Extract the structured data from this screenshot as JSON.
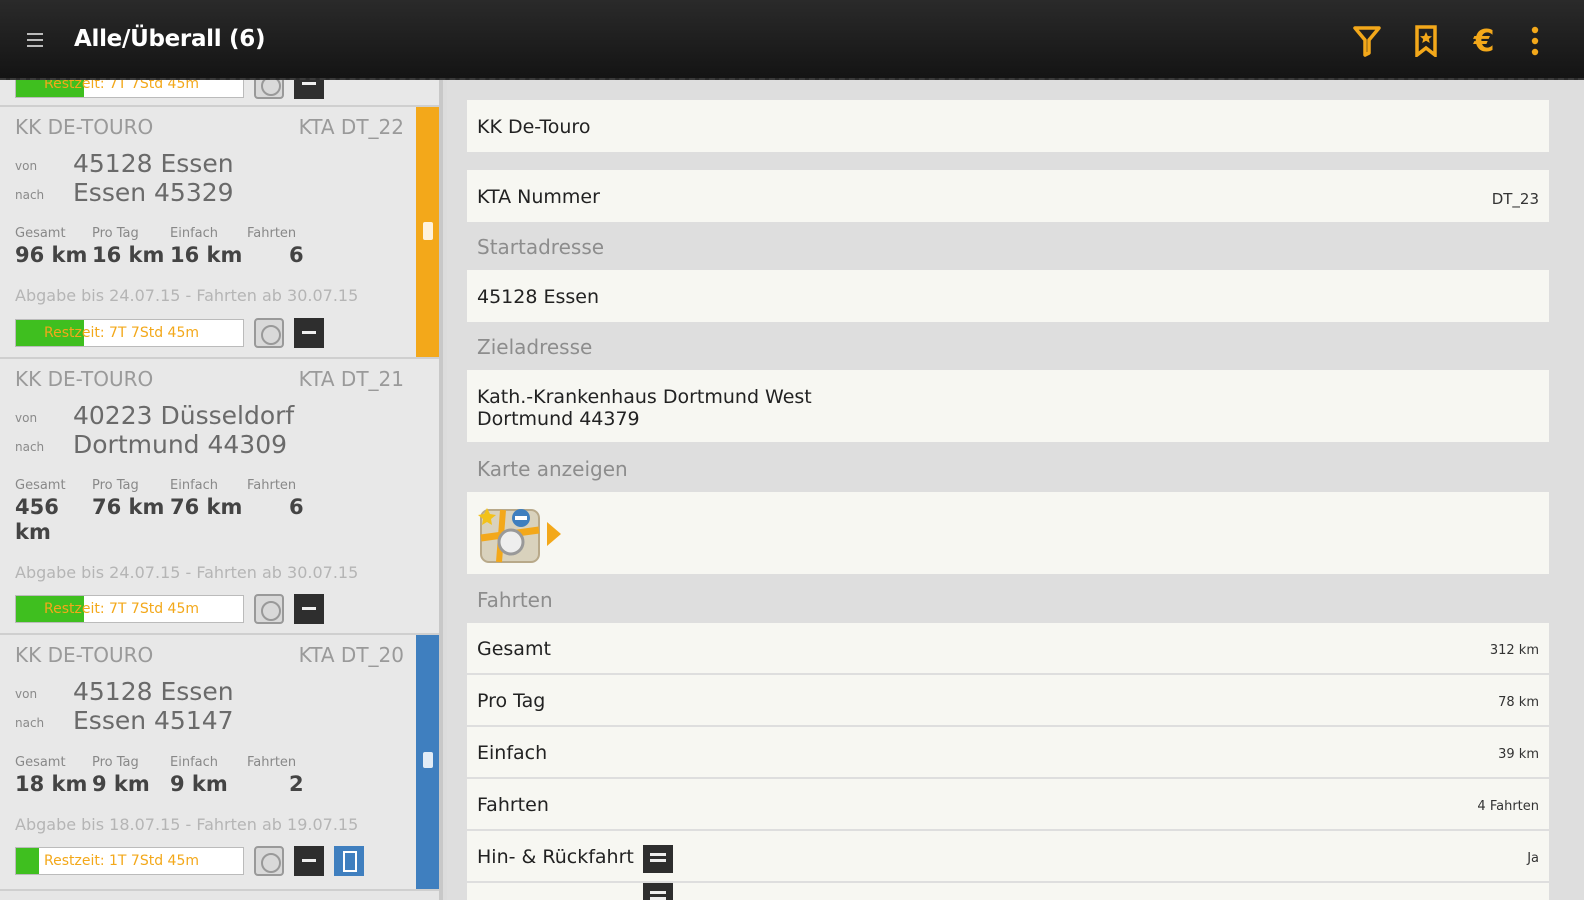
{
  "appbar": {
    "title": "Alle/Überall (6)",
    "icons": [
      "menu-icon",
      "filter-icon",
      "bookmark-icon",
      "euro-icon",
      "overflow-icon"
    ],
    "euro_symbol": "€"
  },
  "colors": {
    "accent": "#f3a81a",
    "green": "#3fbf1f",
    "blue": "#3f7fbf",
    "appbar": "#1c1c1c"
  },
  "list": {
    "top_partial": {
      "remaining": "Restzeit: 7T 7Std 45m"
    },
    "cards": [
      {
        "client": "KK DE-TOURO",
        "code": "KTA DT_22",
        "from_label": "von",
        "from": "45128 Essen",
        "to_label": "nach",
        "to": "Essen 45329",
        "stat_labels": [
          "Gesamt",
          "Pro Tag",
          "Einfach",
          "Fahrten"
        ],
        "stats": [
          "96 km",
          "16 km",
          "16 km",
          "6"
        ],
        "deadline": "Abgabe bis 24.07.15 - Fahrten ab 30.07.15",
        "remaining": "Restzeit: 7T 7Std 45m",
        "remaining_fraction": 0.3,
        "stripe_color": "#f3a81a"
      },
      {
        "client": "KK DE-TOURO",
        "code": "KTA DT_21",
        "from_label": "von",
        "from": "40223 Düsseldorf",
        "to_label": "nach",
        "to": "Dortmund 44309",
        "stat_labels": [
          "Gesamt",
          "Pro Tag",
          "Einfach",
          "Fahrten"
        ],
        "stats": [
          "456 km",
          "76 km",
          "76 km",
          "6"
        ],
        "deadline": "Abgabe bis 24.07.15 - Fahrten ab 30.07.15",
        "remaining": "Restzeit: 7T 7Std 45m",
        "remaining_fraction": 0.3,
        "stripe_color": "#e6e6e6"
      },
      {
        "client": "KK DE-TOURO",
        "code": "KTA DT_20",
        "from_label": "von",
        "from": "45128 Essen",
        "to_label": "nach",
        "to": "Essen 45147",
        "stat_labels": [
          "Gesamt",
          "Pro Tag",
          "Einfach",
          "Fahrten"
        ],
        "stats": [
          "18 km",
          "9 km",
          "9 km",
          "2"
        ],
        "deadline": "Abgabe bis 18.07.15 - Fahrten ab 19.07.15",
        "remaining": "Restzeit: 1T 7Std 45m",
        "remaining_fraction": 0.1,
        "stripe_color": "#3f7fbf"
      }
    ]
  },
  "detail": {
    "client": "KK De-Touro",
    "kta_label": "KTA Nummer",
    "kta_value": "DT_23",
    "start_section": "Startadresse",
    "start": "45128 Essen",
    "dest_section": "Zieladresse",
    "dest_line1": "Kath.-Krankenhaus Dortmund West",
    "dest_line2": "Dortmund 44379",
    "map_section": "Karte anzeigen",
    "trips_section": "Fahrten",
    "rows": [
      {
        "label": "Gesamt",
        "value": "312 km"
      },
      {
        "label": "Pro Tag",
        "value": "78 km"
      },
      {
        "label": "Einfach",
        "value": "39 km"
      },
      {
        "label": "Fahrten",
        "value": "4 Fahrten"
      },
      {
        "label": "Hin- & Rückfahrt",
        "value": "Ja"
      }
    ]
  }
}
